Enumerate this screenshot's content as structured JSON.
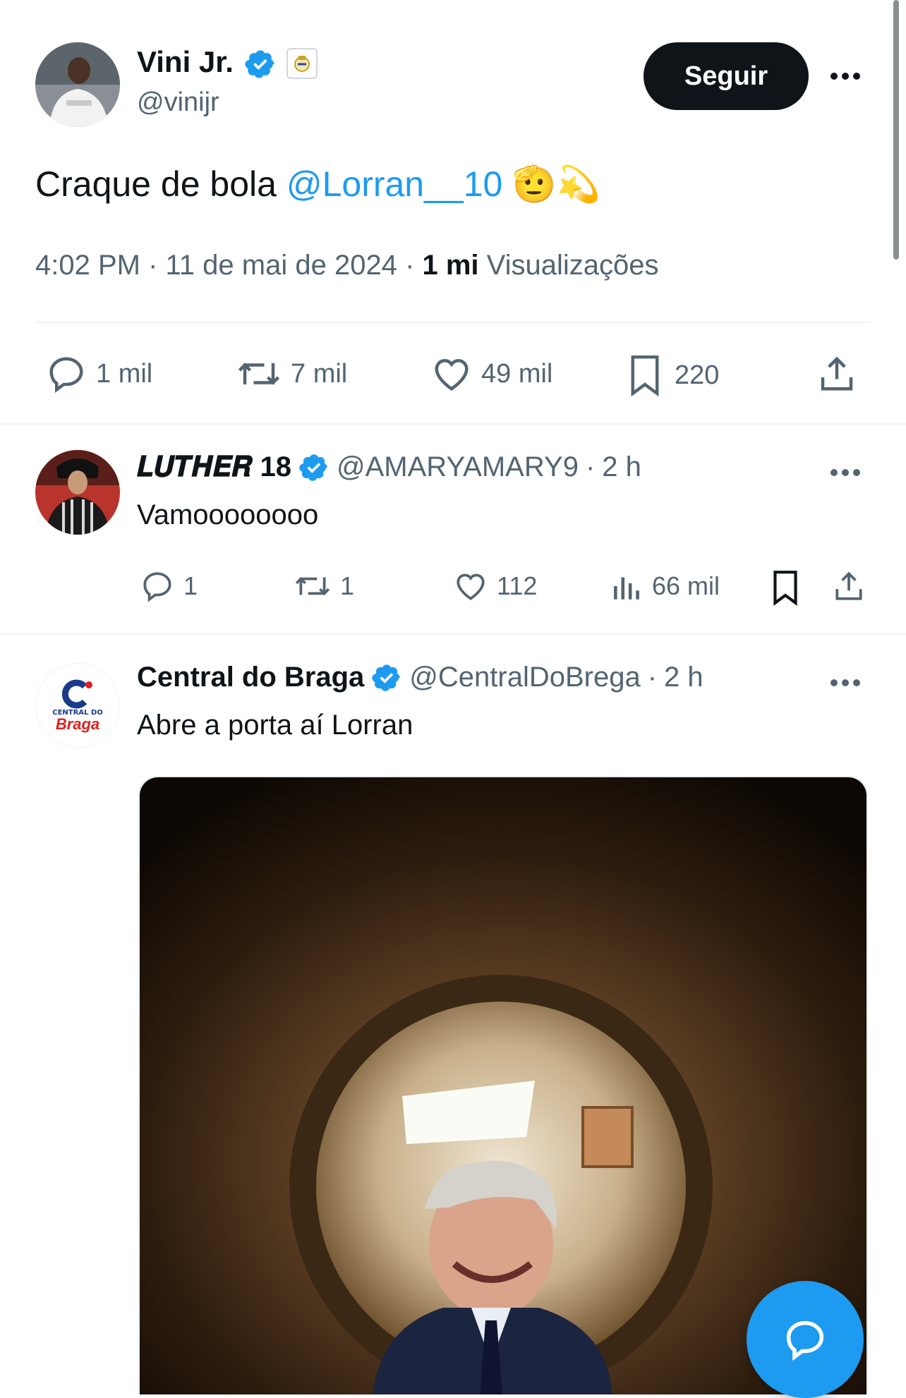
{
  "main_tweet": {
    "author_name": "Vini Jr.",
    "author_handle": "@vinijr",
    "follow_label": "Seguir",
    "text_prefix": "Craque de bola",
    "mention": "@Lorran__10",
    "emojis": "🫡💫",
    "time": "4:02 PM",
    "date": "11 de mai de 2024",
    "views_count": "1 mi",
    "views_label": "Visualizações",
    "stats": {
      "replies": "1 mil",
      "retweets": "7 mil",
      "likes": "49 mil",
      "bookmarks": "220"
    }
  },
  "replies": [
    {
      "author_name": "𝑳𝑼𝑻𝑯𝑬𝑹 18",
      "author_handle": "@AMARYAMARY9",
      "time": "2 h",
      "text": "Vamoooooooo",
      "stats": {
        "replies": "1",
        "retweets": "1",
        "likes": "112",
        "views": "66 mil"
      }
    },
    {
      "author_name": "Central do Braga",
      "author_handle": "@CentralDoBrega",
      "time": "2 h",
      "text": "Abre a porta aí Lorran",
      "logo_text_top": "CENTRAL DO",
      "logo_text_bottom": "Braga"
    }
  ],
  "colors": {
    "accent": "#1d9bf0",
    "text": "#0f1419",
    "muted": "#536471",
    "divider": "#eff3f4"
  },
  "icons": [
    "verified-badge-icon",
    "reply-icon",
    "retweet-icon",
    "like-icon",
    "bookmark-icon",
    "share-icon",
    "views-icon",
    "more-icon",
    "compose-reply-icon"
  ]
}
